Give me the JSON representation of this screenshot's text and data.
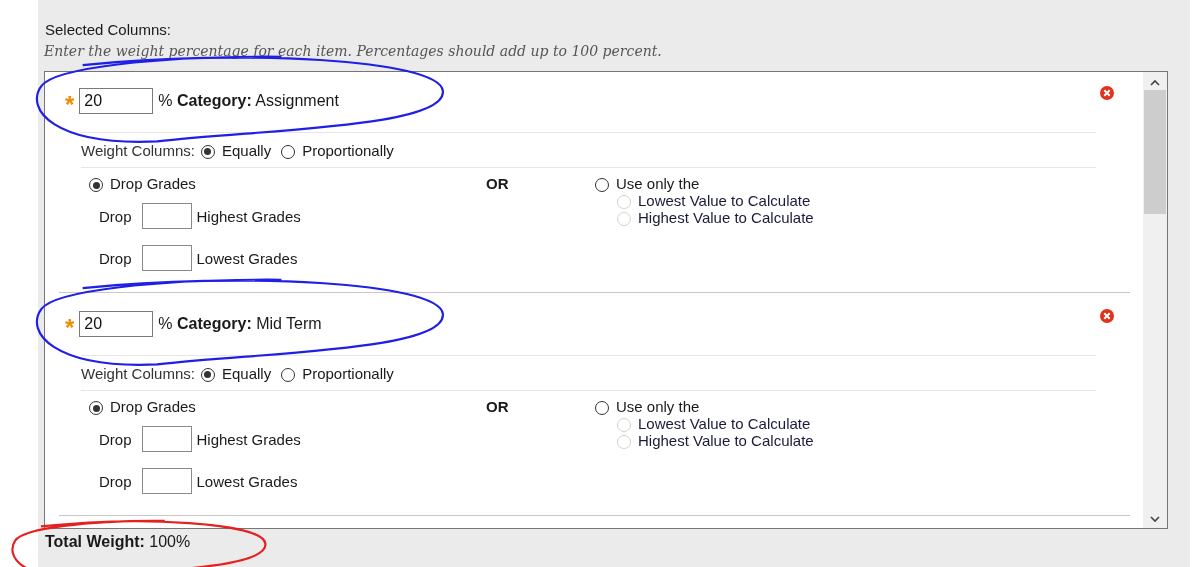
{
  "heading": "Selected Columns:",
  "instructions": "Enter the weight percentage for each item. Percentages should add up to 100 percent.",
  "categories": [
    {
      "required_mark": "*",
      "percent": "20",
      "percent_sign": "%",
      "category_label": "Category:",
      "category_name": "Assignment",
      "circle": {
        "color": "#1f1fe6"
      },
      "weight": {
        "label": "Weight Columns:",
        "options": [
          {
            "label": "Equally",
            "selected": true
          },
          {
            "label": "Proportionally",
            "selected": false
          }
        ]
      },
      "drop_option": {
        "label": "Drop Grades",
        "selected": true
      },
      "drop_rows": [
        {
          "prefix": "Drop",
          "suffix": "Highest Grades"
        },
        {
          "prefix": "Drop",
          "suffix": "Lowest Grades"
        }
      ],
      "or_label": "OR",
      "use_only": {
        "label": "Use only the",
        "selected": false,
        "options": [
          {
            "label": "Lowest Value to Calculate",
            "selected": false,
            "disabled": true
          },
          {
            "label": "Highest Value to Calculate",
            "selected": false,
            "disabled": true
          }
        ]
      }
    },
    {
      "required_mark": "*",
      "percent": "20",
      "percent_sign": "%",
      "category_label": "Category:",
      "category_name": "Mid Term",
      "circle": {
        "color": "#1f1fe6"
      },
      "weight": {
        "label": "Weight Columns:",
        "options": [
          {
            "label": "Equally",
            "selected": true
          },
          {
            "label": "Proportionally",
            "selected": false
          }
        ]
      },
      "drop_option": {
        "label": "Drop Grades",
        "selected": true
      },
      "drop_rows": [
        {
          "prefix": "Drop",
          "suffix": "Highest Grades"
        },
        {
          "prefix": "Drop",
          "suffix": "Lowest Grades"
        }
      ],
      "or_label": "OR",
      "use_only": {
        "label": "Use only the",
        "selected": false,
        "options": [
          {
            "label": "Lowest Value to Calculate",
            "selected": false,
            "disabled": true
          },
          {
            "label": "Highest Value to Calculate",
            "selected": false,
            "disabled": true
          }
        ]
      }
    }
  ],
  "total": {
    "label": "Total Weight:",
    "value": "100%",
    "circle": {
      "color": "#e61f1f"
    }
  }
}
